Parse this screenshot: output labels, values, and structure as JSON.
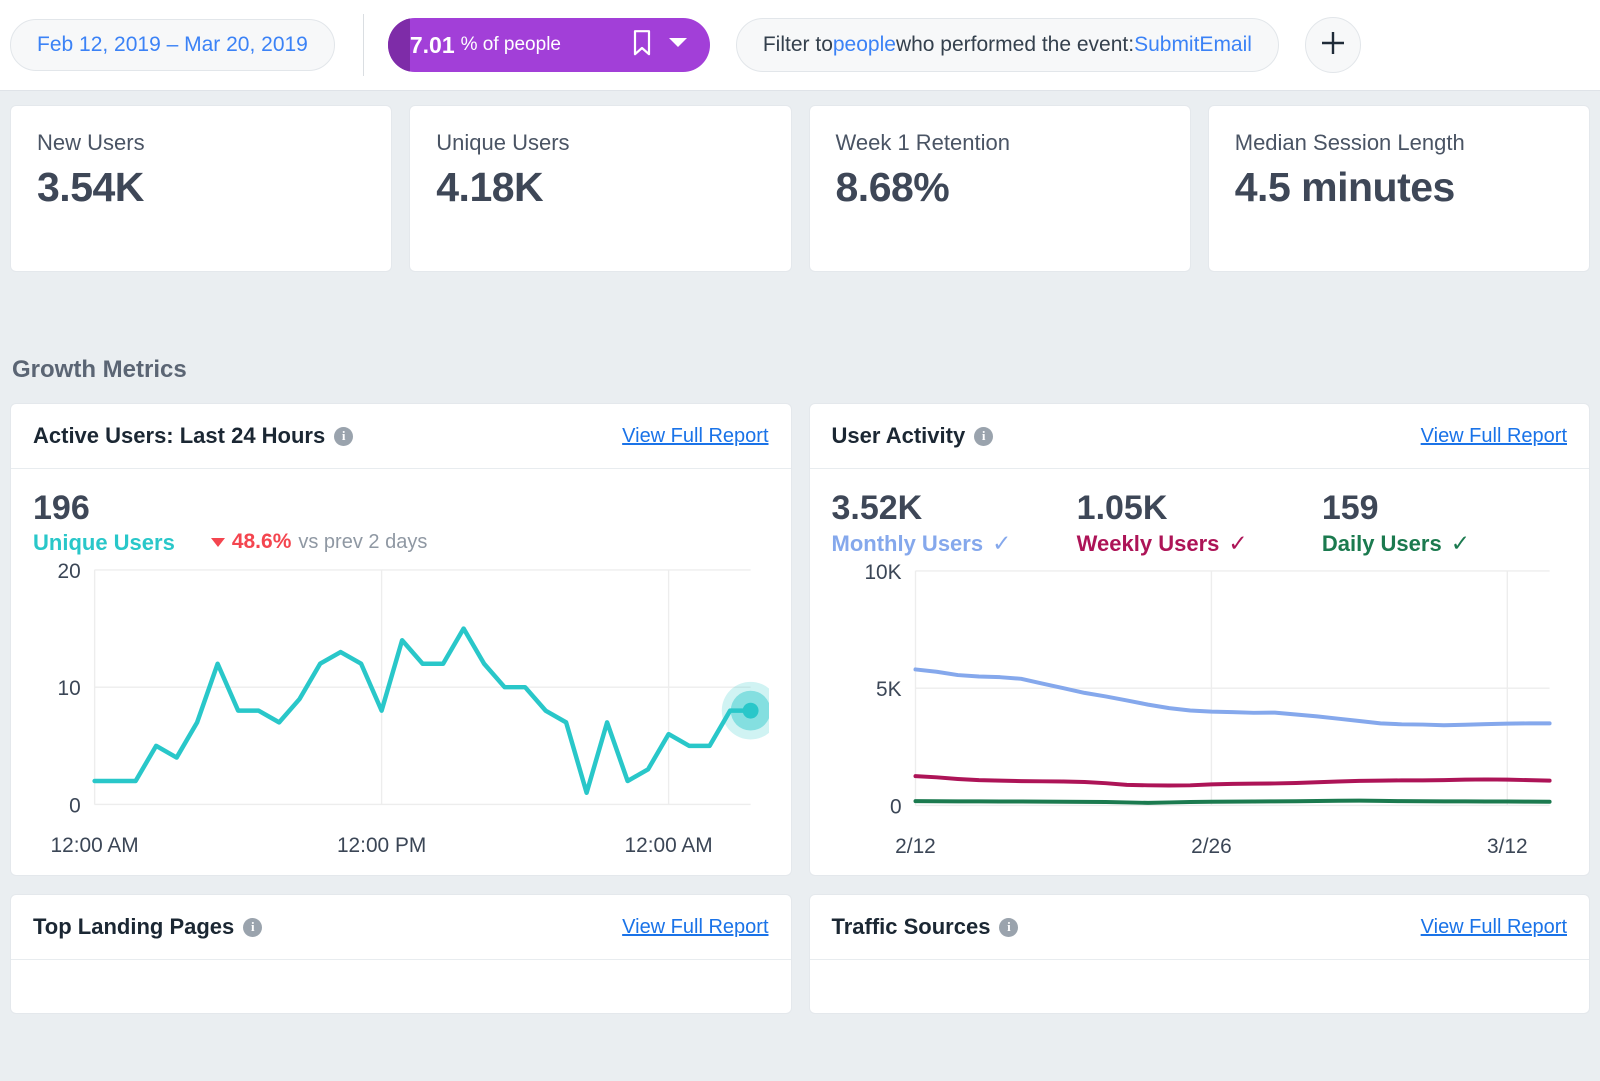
{
  "topbar": {
    "date_range": "Feb 12, 2019 – Mar 20, 2019",
    "segment": {
      "value": "7.01",
      "unit": "% of people",
      "bookmark_icon": "bookmark-icon",
      "caret_icon": "chevron-down-icon",
      "color": "#a23fd8",
      "cap_color": "#7e2ca8"
    },
    "filter": {
      "prefix": "Filter to ",
      "entity": "people",
      "mid": " who performed the event: ",
      "event": "SubmitEmail"
    },
    "add_button": "+"
  },
  "kpis": [
    {
      "label": "New Users",
      "value": "3.54K"
    },
    {
      "label": "Unique Users",
      "value": "4.18K"
    },
    {
      "label": "Week 1 Retention",
      "value": "8.68%"
    },
    {
      "label": "Median Session Length",
      "value": "4.5 minutes"
    }
  ],
  "section": {
    "title": "Growth Metrics"
  },
  "active_users": {
    "title": "Active Users: Last 24 Hours",
    "view_link": "View Full Report",
    "value": "196",
    "metric_label": "Unique Users",
    "metric_color": "#29c7c9",
    "delta": "48.6%",
    "delta_direction": "down",
    "delta_color": "#f4454f",
    "delta_suffix": "vs prev 2 days"
  },
  "user_activity": {
    "title": "User Activity",
    "view_link": "View Full Report",
    "stats": [
      {
        "value": "3.52K",
        "label": "Monthly Users",
        "color": "#85a8ec",
        "checked": true
      },
      {
        "value": "1.05K",
        "label": "Weekly Users",
        "color": "#ad1457",
        "checked": true
      },
      {
        "value": "159",
        "label": "Daily Users",
        "color": "#1b7a4f",
        "checked": true
      }
    ]
  },
  "bottom_cards": [
    {
      "title": "Top Landing Pages",
      "view_link": "View Full Report"
    },
    {
      "title": "Traffic Sources",
      "view_link": "View Full Report"
    }
  ],
  "chart_data": [
    {
      "type": "line",
      "title": "Active Users: Last 24 Hours",
      "xlabel": "",
      "ylabel": "",
      "ylim": [
        0,
        20
      ],
      "yticks": [
        0,
        10,
        20
      ],
      "ytick_labels": [
        "0",
        "10",
        "20"
      ],
      "xtick_labels": [
        "12:00 AM",
        "12:00 PM",
        "12:00 AM"
      ],
      "xtick_positions": [
        0,
        14,
        28
      ],
      "grid": true,
      "legend": "none",
      "series": [
        {
          "name": "Unique Users",
          "color": "#29c7c9",
          "values": [
            2,
            2,
            2,
            5,
            4,
            7,
            12,
            8,
            8,
            7,
            9,
            12,
            13,
            12,
            8,
            14,
            12,
            12,
            15,
            12,
            10,
            10,
            8,
            7,
            1,
            7,
            2,
            3,
            6,
            5,
            5,
            8,
            8
          ]
        }
      ],
      "highlight_point": {
        "index": 32,
        "value": 8
      }
    },
    {
      "type": "line",
      "title": "User Activity",
      "xlabel": "",
      "ylabel": "",
      "ylim": [
        0,
        10000
      ],
      "yticks": [
        0,
        5000,
        10000
      ],
      "ytick_labels": [
        "0",
        "5K",
        "10K"
      ],
      "xtick_labels": [
        "2/12",
        "2/26",
        "3/12"
      ],
      "xtick_positions": [
        0,
        14,
        28
      ],
      "grid": true,
      "legend": "top",
      "series": [
        {
          "name": "Monthly Users",
          "color": "#85a8ec",
          "values": [
            5800,
            5700,
            5560,
            5500,
            5470,
            5400,
            5200,
            5000,
            4800,
            4650,
            4480,
            4300,
            4150,
            4050,
            4000,
            3980,
            3950,
            3960,
            3880,
            3800,
            3700,
            3600,
            3500,
            3460,
            3450,
            3420,
            3440,
            3470,
            3490,
            3500,
            3500
          ]
        },
        {
          "name": "Weekly Users",
          "color": "#ad1457",
          "values": [
            1250,
            1200,
            1130,
            1080,
            1060,
            1040,
            1030,
            1020,
            1000,
            950,
            880,
            860,
            850,
            860,
            900,
            920,
            930,
            940,
            960,
            990,
            1020,
            1050,
            1060,
            1070,
            1070,
            1080,
            1100,
            1110,
            1100,
            1080,
            1060
          ]
        },
        {
          "name": "Daily Users",
          "color": "#1b7a4f",
          "values": [
            185,
            180,
            175,
            175,
            170,
            170,
            165,
            160,
            155,
            150,
            130,
            110,
            130,
            150,
            160,
            165,
            170,
            175,
            180,
            190,
            200,
            205,
            195,
            185,
            180,
            175,
            175,
            170,
            170,
            165,
            160
          ]
        }
      ]
    }
  ]
}
